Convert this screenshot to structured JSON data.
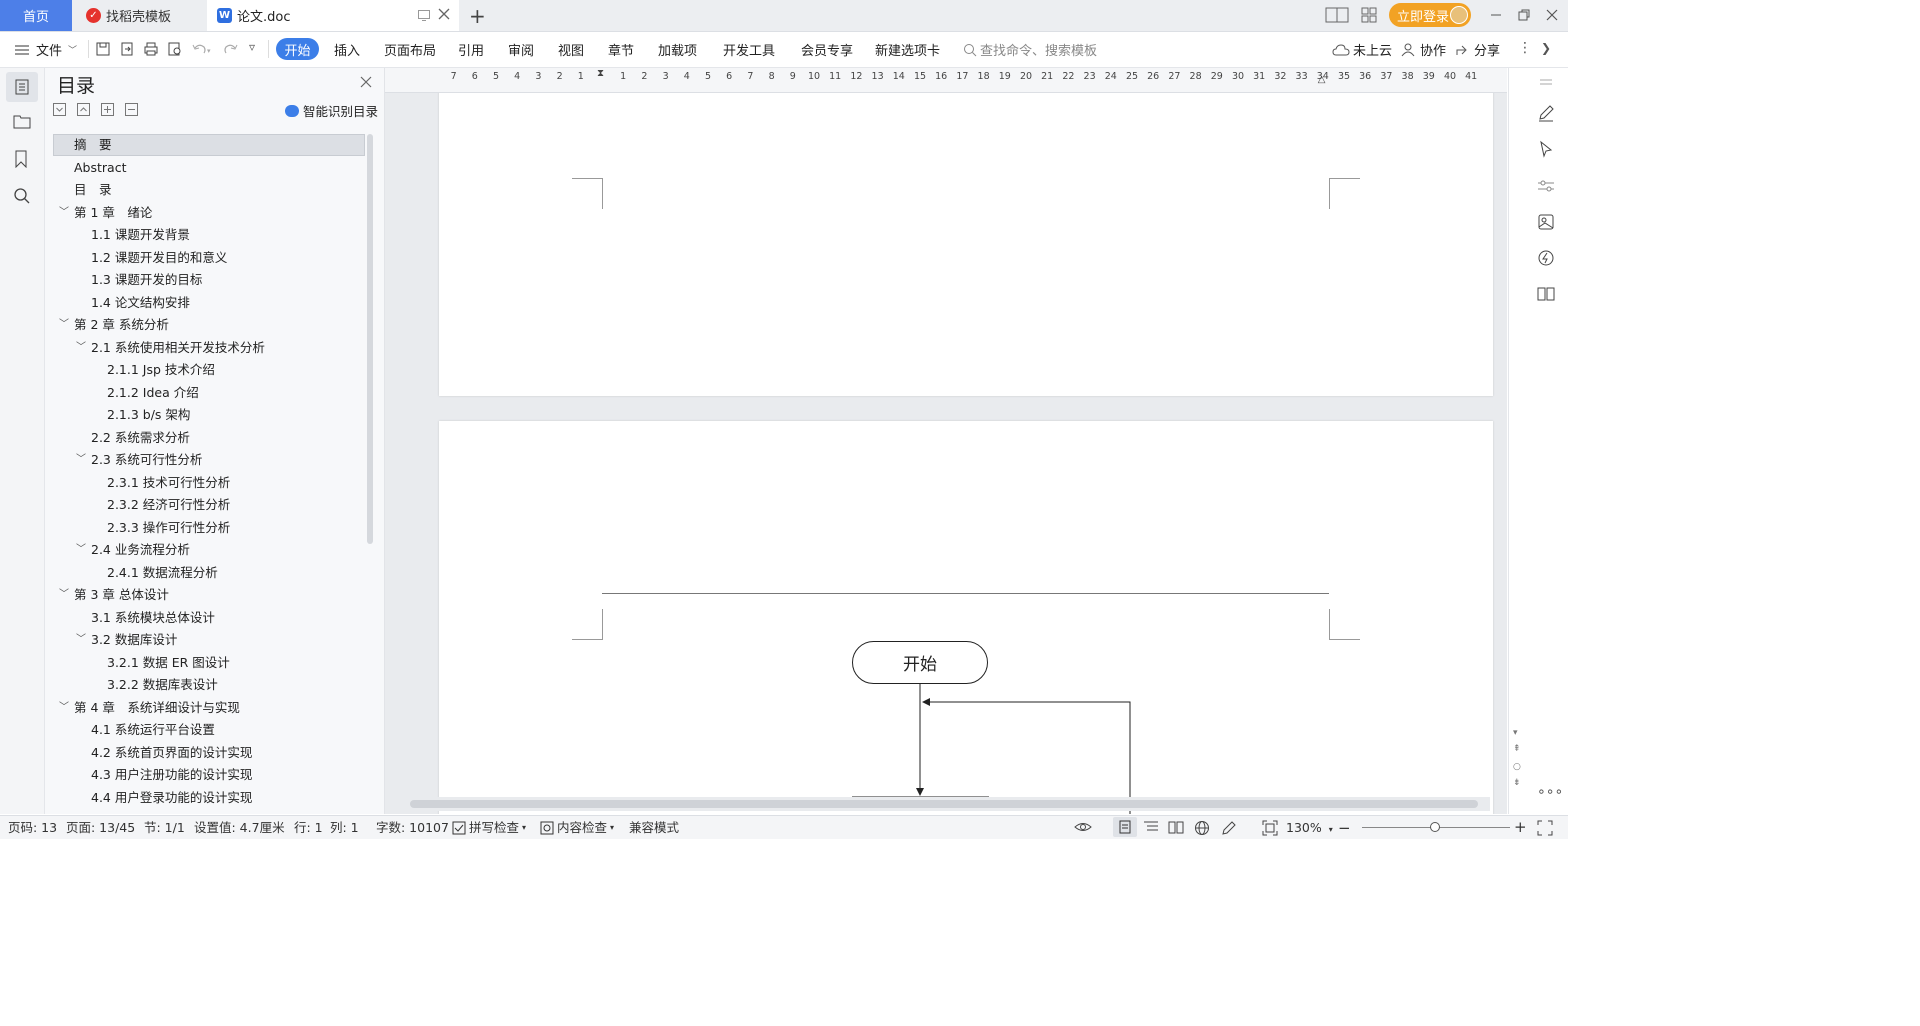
{
  "tabs": {
    "home": "首页",
    "template": "找稻壳模板",
    "doc": "论文.doc",
    "new_tab": "+",
    "login": "立即登录"
  },
  "toolbar": {
    "file": "文件",
    "items": [
      "开始",
      "插入",
      "页面布局",
      "引用",
      "审阅",
      "视图",
      "章节",
      "加载项",
      "开发工具",
      "会员专享",
      "新建选项卡"
    ],
    "search_placeholder": "查找命令、搜索模板",
    "cloud": "未上云",
    "collab": "协作",
    "share": "分享"
  },
  "toc": {
    "title": "目录",
    "smart": "智能识别目录",
    "items": [
      {
        "label": "摘　要",
        "level": 1,
        "chev": false
      },
      {
        "label": "Abstract",
        "level": 1,
        "chev": false
      },
      {
        "label": "目　录",
        "level": 1,
        "chev": false
      },
      {
        "label": "第 1 章　绪论",
        "level": 1,
        "chev": true
      },
      {
        "label": "1.1 课题开发背景",
        "level": 2,
        "chev": false
      },
      {
        "label": "1.2 课题开发目的和意义",
        "level": 2,
        "chev": false
      },
      {
        "label": "1.3 课题开发的目标",
        "level": 2,
        "chev": false
      },
      {
        "label": "1.4 论文结构安排",
        "level": 2,
        "chev": false
      },
      {
        "label": "第 2 章  系统分析",
        "level": 1,
        "chev": true
      },
      {
        "label": "2.1 系统使用相关开发技术分析",
        "level": 2,
        "chev": true
      },
      {
        "label": "2.1.1 Jsp 技术介绍",
        "level": 3,
        "chev": false
      },
      {
        "label": "2.1.2 Idea 介绍",
        "level": 3,
        "chev": false
      },
      {
        "label": "2.1.3 b/s 架构",
        "level": 3,
        "chev": false
      },
      {
        "label": "2.2 系统需求分析",
        "level": 2,
        "chev": false
      },
      {
        "label": "2.3 系统可行性分析",
        "level": 2,
        "chev": true
      },
      {
        "label": "2.3.1 技术可行性分析",
        "level": 3,
        "chev": false
      },
      {
        "label": "2.3.2 经济可行性分析",
        "level": 3,
        "chev": false
      },
      {
        "label": "2.3.3  操作可行性分析",
        "level": 3,
        "chev": false
      },
      {
        "label": "2.4 业务流程分析",
        "level": 2,
        "chev": true
      },
      {
        "label": "2.4.1 数据流程分析",
        "level": 3,
        "chev": false
      },
      {
        "label": "第 3 章  总体设计",
        "level": 1,
        "chev": true
      },
      {
        "label": "3.1 系统模块总体设计",
        "level": 2,
        "chev": false
      },
      {
        "label": "3.2 数据库设计",
        "level": 2,
        "chev": true
      },
      {
        "label": "3.2.1 数据 ER 图设计",
        "level": 3,
        "chev": false
      },
      {
        "label": "3.2.2 数据库表设计",
        "level": 3,
        "chev": false
      },
      {
        "label": "第 4 章　系统详细设计与实现",
        "level": 1,
        "chev": true
      },
      {
        "label": "4.1 系统运行平台设置",
        "level": 2,
        "chev": false
      },
      {
        "label": "4.2 系统首页界面的设计实现",
        "level": 2,
        "chev": false
      },
      {
        "label": "4.3 用户注册功能的设计实现",
        "level": 2,
        "chev": false
      },
      {
        "label": "4.4 用户登录功能的设计实现",
        "level": 2,
        "chev": false
      }
    ]
  },
  "ruler": {
    "left_numbers": [
      "7",
      "6",
      "5",
      "4",
      "3",
      "2",
      "1"
    ],
    "right_numbers": [
      "1",
      "2",
      "3",
      "4",
      "5",
      "6",
      "7",
      "8",
      "9",
      "10",
      "11",
      "12",
      "13",
      "14",
      "15",
      "16",
      "17",
      "18",
      "19",
      "20",
      "21",
      "22",
      "23",
      "24",
      "25",
      "26",
      "27",
      "28",
      "29",
      "30",
      "31",
      "32",
      "33",
      "34",
      "35",
      "36",
      "37",
      "38",
      "39",
      "40",
      "41"
    ]
  },
  "document": {
    "flow_start": "开始"
  },
  "status": {
    "page_code": "页码: 13",
    "pages": "页面: 13/45",
    "section": "节: 1/1",
    "setting": "设置值: 4.7厘米",
    "row": "行: 1",
    "col": "列: 1",
    "words": "字数: 10107",
    "spell": "拼写检查",
    "content": "内容检查",
    "compat": "兼容模式",
    "zoom": "130%"
  },
  "colors": {
    "accent": "#3c7ee8",
    "home_tab": "#4d7fe8",
    "login": "#f2a224"
  }
}
